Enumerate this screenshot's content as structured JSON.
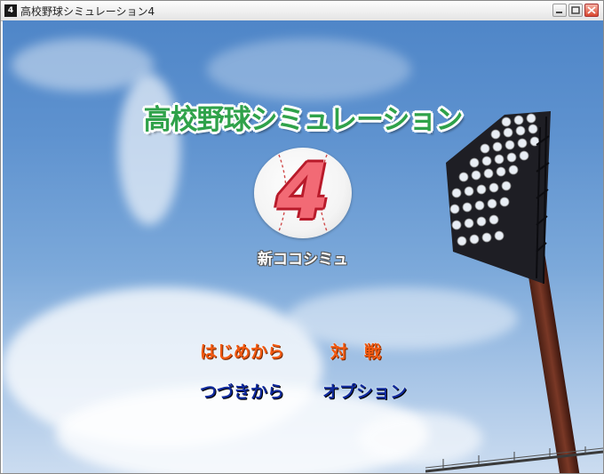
{
  "window": {
    "title": "高校野球シミュレーション4",
    "icon_label": "4"
  },
  "title_screen": {
    "logo": "高校野球シミュレーション",
    "number": "4",
    "subtitle": "新ココシミュ"
  },
  "menu": {
    "new_game": "はじめから",
    "versus": "対　戦",
    "continue": "つづきから",
    "options": "オプション"
  },
  "colors": {
    "logo": "#2fa24a",
    "number": "#f26a75",
    "menu_top_row": "#f25a12",
    "menu_bottom_row": "#102a9c"
  },
  "icons": [
    "minimize-icon",
    "maximize-icon",
    "close-icon"
  ]
}
